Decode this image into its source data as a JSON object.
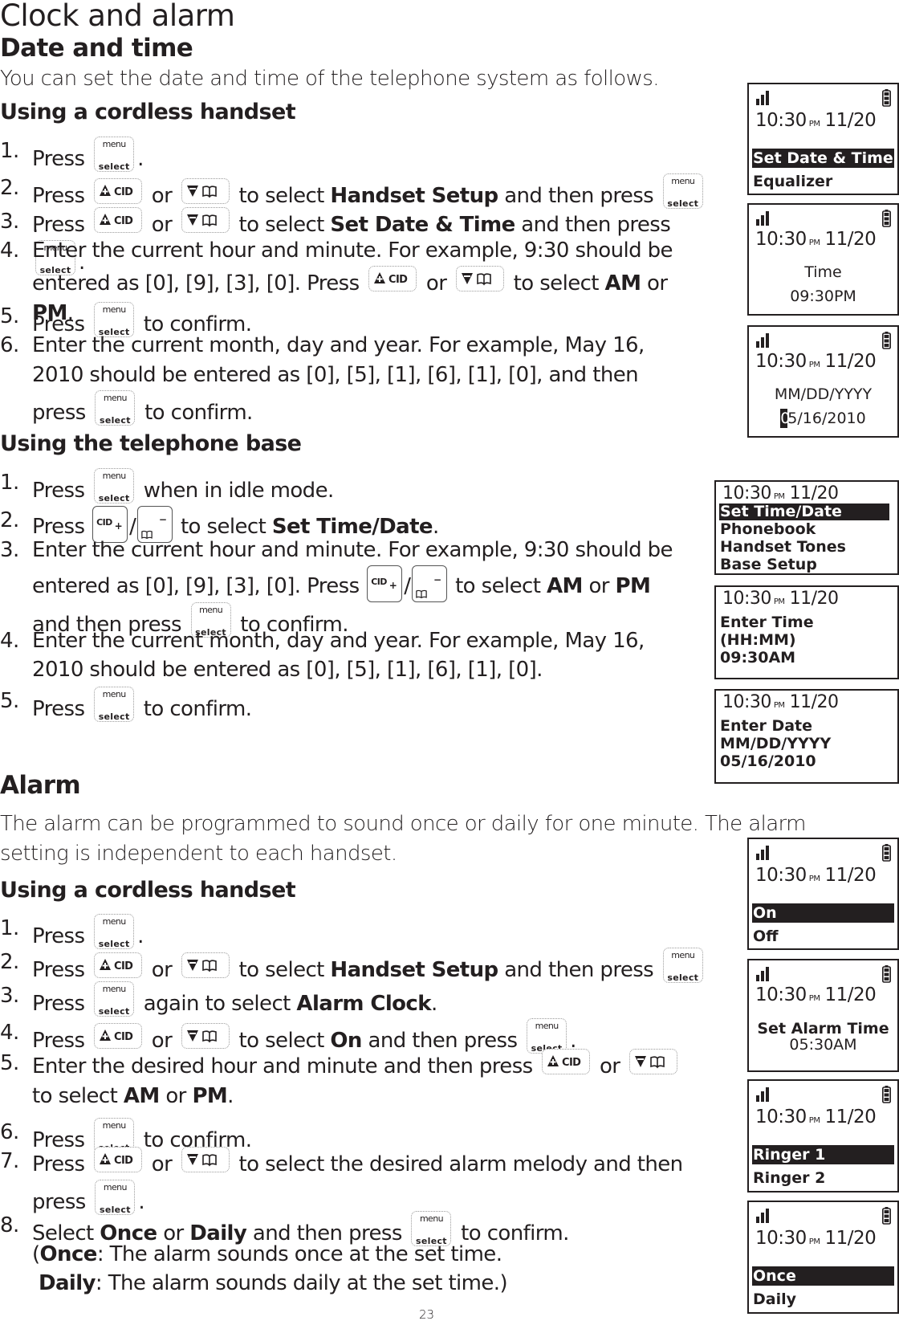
{
  "page": {
    "title": "Clock and alarm",
    "page_number": "23"
  },
  "keys": {
    "menu_top": "menu",
    "menu_bottom": "select",
    "cid": "CID",
    "plus": "+",
    "minus": "−"
  },
  "date_time": {
    "heading": "Date and time",
    "intro": "You can set the date and time of the telephone system as follows.",
    "handset": {
      "heading": "Using a cordless handset",
      "steps": [
        {
          "num": "1.",
          "parts": [
            "Press",
            "."
          ]
        },
        {
          "num": "2.",
          "parts": [
            "Press",
            "or",
            "to select",
            "Handset Setup",
            "and then press",
            "."
          ]
        },
        {
          "num": "3.",
          "parts": [
            "Press",
            "or",
            "to select",
            "Set Date & Time",
            "and then press",
            "."
          ]
        },
        {
          "num": "4.",
          "parts": [
            "Enter the current hour and minute. For example, 9:30 should be entered as [0], [9], [3], [0]. Press",
            "or",
            "to select",
            "AM",
            "or",
            "PM",
            "."
          ]
        },
        {
          "num": "5.",
          "parts": [
            "Press",
            "to confirm."
          ]
        },
        {
          "num": "6.",
          "parts": [
            "Enter the current month, day and year. For example, May 16, 2010 should be entered as [0], [5], [1], [6], [1], [0], and then press",
            "to confirm."
          ]
        }
      ]
    },
    "base": {
      "heading": "Using the telephone base",
      "steps": [
        {
          "num": "1.",
          "parts": [
            "Press",
            "when in idle mode."
          ]
        },
        {
          "num": "2.",
          "parts": [
            "Press",
            "/",
            "to select",
            "Set Time/Date",
            "."
          ]
        },
        {
          "num": "3.",
          "parts": [
            "Enter the current hour and minute. For example, 9:30 should be entered as [0], [9], [3], [0]. Press",
            "/",
            "to select",
            "AM",
            "or",
            "PM",
            "and then press",
            "to confirm."
          ]
        },
        {
          "num": "4.",
          "parts": [
            "Enter the current month, day and year. For example, May 16, 2010 should be entered as [0], [5], [1], [6], [1], [0]."
          ]
        },
        {
          "num": "5.",
          "parts": [
            "Press",
            "to confirm."
          ]
        }
      ]
    }
  },
  "alarm": {
    "heading": "Alarm",
    "intro": "The alarm can be programmed to sound once or daily for one minute. The alarm setting is independent to each handset.",
    "handset": {
      "heading": "Using a cordless handset",
      "steps": [
        {
          "num": "1.",
          "parts": [
            "Press",
            "."
          ]
        },
        {
          "num": "2.",
          "parts": [
            "Press",
            "or",
            "to select",
            "Handset Setup",
            "and then press",
            "."
          ]
        },
        {
          "num": "3.",
          "parts": [
            "Press",
            "again to select",
            "Alarm Clock",
            "."
          ]
        },
        {
          "num": "4.",
          "parts": [
            "Press",
            "or",
            "to select",
            "On",
            "and then press",
            "."
          ]
        },
        {
          "num": "5.",
          "parts": [
            "Enter the desired hour and minute and then press",
            "or",
            "to select",
            "AM",
            "or",
            "PM",
            "."
          ]
        },
        {
          "num": "6.",
          "parts": [
            "Press",
            "to confirm."
          ]
        },
        {
          "num": "7.",
          "parts": [
            "Press",
            "or",
            "to select the desired alarm melody and then press",
            "."
          ]
        },
        {
          "num": "8.",
          "parts": [
            "Select",
            "Once",
            "or",
            "Daily",
            "and then press",
            "to confirm."
          ]
        }
      ],
      "note": {
        "once_label": "Once",
        "once_text": ": The alarm sounds once at the set time.",
        "daily_label": "Daily",
        "daily_text": ": The alarm sounds daily at the set time.)",
        "open_paren": "("
      }
    }
  },
  "screens": {
    "clock_time": "10:30",
    "clock_ampm": "PM",
    "clock_date": "11/20",
    "handset_date": [
      {
        "rows": [
          {
            "text": "Set Date & Time",
            "selected": true
          },
          {
            "text": "Equalizer",
            "selected": false
          }
        ]
      },
      {
        "center": [
          "Time",
          "09:30PM"
        ]
      },
      {
        "center": [
          "MM/DD/YYYY",
          "05/16/2010"
        ],
        "cursor_char": "0",
        "rest": "5/16/2010"
      }
    ],
    "base": [
      {
        "rows": [
          {
            "text": "Set Time/Date",
            "selected": true
          },
          {
            "text": "Phonebook"
          },
          {
            "text": "Handset Tones"
          },
          {
            "text": "Base Setup"
          }
        ]
      },
      {
        "rows": [
          {
            "text": "Enter Time"
          },
          {
            "text": "(HH:MM)"
          },
          {
            "text": "09:30AM"
          }
        ]
      },
      {
        "rows": [
          {
            "text": "Enter Date"
          },
          {
            "text": "MM/DD/YYYY"
          },
          {
            "text": "05/16/2010"
          }
        ]
      }
    ],
    "alarm": [
      {
        "rows": [
          {
            "text": "On",
            "selected": true
          },
          {
            "text": "Off",
            "selected": false
          }
        ]
      },
      {
        "center": [
          "Set Alarm Time",
          "05:30AM"
        ]
      },
      {
        "rows": [
          {
            "text": "Ringer 1",
            "selected": true
          },
          {
            "text": "Ringer 2",
            "selected": false
          }
        ]
      },
      {
        "rows": [
          {
            "text": "Once",
            "selected": true
          },
          {
            "text": "Daily",
            "selected": false
          }
        ]
      }
    ]
  }
}
